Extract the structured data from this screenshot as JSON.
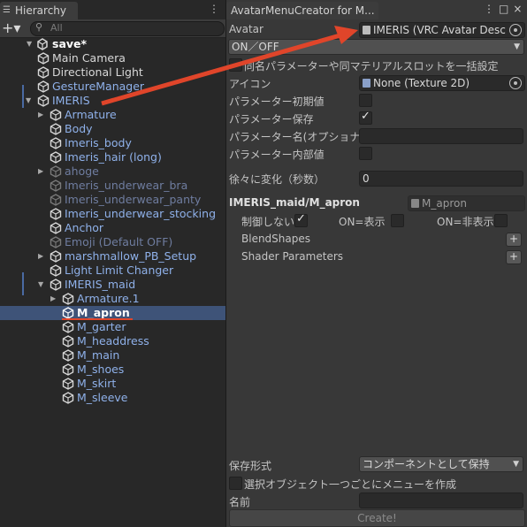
{
  "hierarchy": {
    "tab_label": "Hierarchy",
    "menu_glyph": "⋮",
    "add_glyph": "+▾",
    "search_placeholder": "All",
    "scene_name": "save*",
    "rows": [
      {
        "label": "Main Camera",
        "depth": 1,
        "style": "norm",
        "arrow": ""
      },
      {
        "label": "Directional Light",
        "depth": 1,
        "style": "norm",
        "arrow": ""
      },
      {
        "label": "GestureManager",
        "depth": 1,
        "style": "blue",
        "arrow": ""
      },
      {
        "label": "IMERIS",
        "depth": 1,
        "style": "blue",
        "arrow": "▼"
      },
      {
        "label": "Armature",
        "depth": 2,
        "style": "blue",
        "arrow": "▶"
      },
      {
        "label": "Body",
        "depth": 2,
        "style": "blue",
        "arrow": ""
      },
      {
        "label": "Imeris_body",
        "depth": 2,
        "style": "blue",
        "arrow": ""
      },
      {
        "label": "Imeris_hair (long)",
        "depth": 2,
        "style": "blue",
        "arrow": ""
      },
      {
        "label": "ahoge",
        "depth": 2,
        "style": "dim",
        "arrow": "▶"
      },
      {
        "label": "Imeris_underwear_bra",
        "depth": 2,
        "style": "dim",
        "arrow": ""
      },
      {
        "label": "Imeris_underwear_panty",
        "depth": 2,
        "style": "dim",
        "arrow": ""
      },
      {
        "label": "Imeris_underwear_stocking",
        "depth": 2,
        "style": "blue",
        "arrow": ""
      },
      {
        "label": "Anchor",
        "depth": 2,
        "style": "blue",
        "arrow": ""
      },
      {
        "label": "Emoji (Default OFF)",
        "depth": 2,
        "style": "dim",
        "arrow": ""
      },
      {
        "label": "marshmallow_PB_Setup",
        "depth": 2,
        "style": "blue",
        "arrow": "▶"
      },
      {
        "label": "Light Limit Changer",
        "depth": 2,
        "style": "blue",
        "arrow": ""
      },
      {
        "label": "IMERIS_maid",
        "depth": 2,
        "style": "blue",
        "arrow": "▼"
      },
      {
        "label": "Armature.1",
        "depth": 3,
        "style": "blue",
        "arrow": "▶"
      },
      {
        "label": "M_apron",
        "depth": 3,
        "style": "white",
        "arrow": "",
        "selected": true
      },
      {
        "label": "M_garter",
        "depth": 3,
        "style": "blue",
        "arrow": ""
      },
      {
        "label": "M_headdress",
        "depth": 3,
        "style": "blue",
        "arrow": ""
      },
      {
        "label": "M_main",
        "depth": 3,
        "style": "blue",
        "arrow": ""
      },
      {
        "label": "M_shoes",
        "depth": 3,
        "style": "blue",
        "arrow": ""
      },
      {
        "label": "M_skirt",
        "depth": 3,
        "style": "blue",
        "arrow": ""
      },
      {
        "label": "M_sleeve",
        "depth": 3,
        "style": "blue",
        "arrow": ""
      }
    ]
  },
  "amc": {
    "tab_label": "AvatarMenuCreator for M...",
    "window_controls": "⋮□×",
    "avatar_label": "Avatar",
    "avatar_value": "IMERIS (VRC Avatar Descrip",
    "mode_value": "ON／OFF",
    "batch_label": "同名パラメーターや同マテリアルスロットを一括設定",
    "icon_label": "アイコン",
    "icon_value": "None (Texture 2D)",
    "param_default_label": "パラメーター初期値",
    "param_save_label": "パラメーター保存",
    "param_name_label": "パラメーター名(オプショナル)",
    "param_internal_label": "パラメーター内部値",
    "gradual_label": "徐々に変化（秒数）",
    "gradual_value": "0",
    "object_path": "IMERIS_maid/M_apron",
    "object_ref": "M_apron",
    "no_control_label": "制御しない",
    "on_show_label": "ON=表示",
    "on_hide_label": "ON=非表示",
    "blendshapes_label": "BlendShapes",
    "shader_params_label": "Shader Parameters",
    "save_format_label": "保存形式",
    "save_format_value": "コンポーネントとして保持",
    "per_object_label": "選択オブジェクト一つごとにメニューを作成",
    "name_label": "名前",
    "create_label": "Create!",
    "plus_glyph": "+",
    "checks": {
      "batch": false,
      "param_default": false,
      "param_save": true,
      "param_internal": false,
      "no_control": true,
      "on_show": false,
      "on_hide": false,
      "per_object": false
    }
  },
  "colors": {
    "annotation": "#e0452a",
    "selection": "#3e5378",
    "prefab_blue": "#8fb1ea"
  }
}
